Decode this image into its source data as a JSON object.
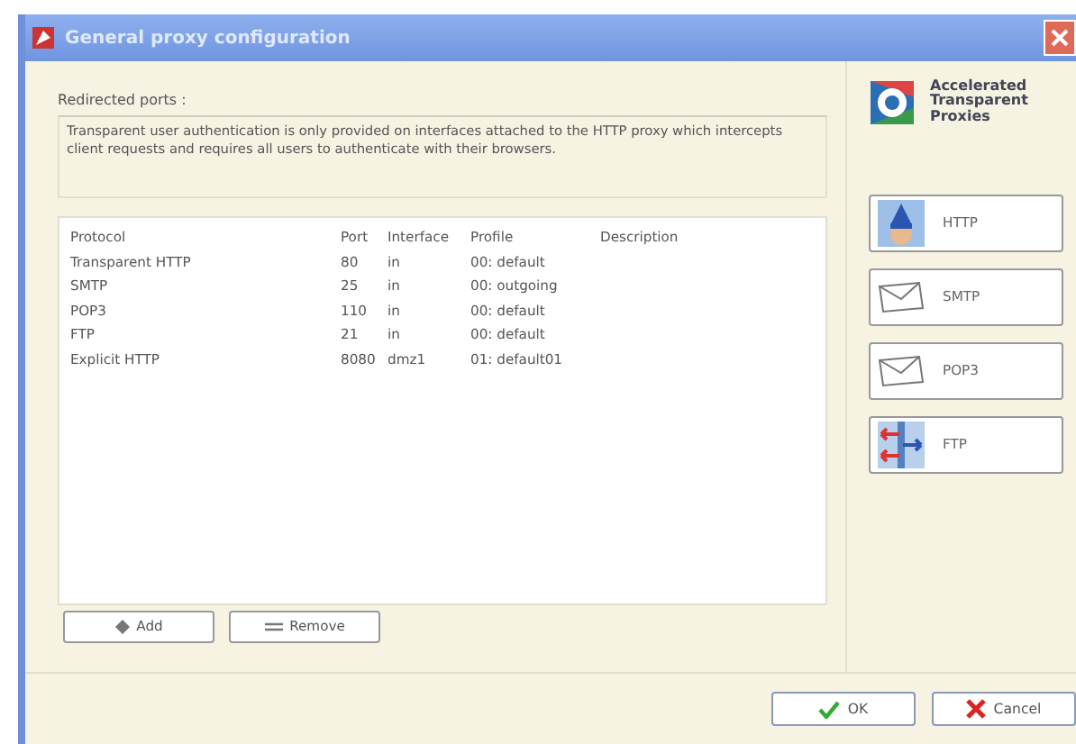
{
  "window": {
    "title": "General proxy configuration"
  },
  "section_label": "Redirected ports :",
  "note": "Transparent user authentication is only provided on interfaces attached to the HTTP proxy which intercepts client requests and requires all users to authenticate with their browsers.",
  "table": {
    "columns": [
      "Protocol",
      "Port",
      "Interface",
      "Profile",
      "Description"
    ],
    "rows": [
      {
        "cells": [
          "Transparent HTTP",
          "80",
          "in",
          "00: default"
        ]
      },
      {
        "cells": [
          "SMTP",
          "25",
          "in",
          "00: outgoing"
        ]
      },
      {
        "cells": [
          "POP3",
          "110",
          "in",
          "00: default"
        ]
      },
      {
        "cells": [
          "FTP",
          "21",
          "in",
          "00: default"
        ]
      },
      {
        "cells": [
          "Explicit HTTP",
          "8080",
          "dmz1",
          "01: default01"
        ]
      }
    ]
  },
  "list_buttons": [
    {
      "label": "Add",
      "kind": "add"
    },
    {
      "label": "Remove",
      "kind": "remove"
    }
  ],
  "sidebar": {
    "heading": "Accelerated Transparent Proxies",
    "buttons": [
      {
        "label": "HTTP",
        "kind": "http"
      },
      {
        "label": "SMTP",
        "kind": "mail"
      },
      {
        "label": "POP3",
        "kind": "mail"
      },
      {
        "label": "FTP",
        "kind": "ftp"
      }
    ]
  },
  "dialog_buttons": [
    {
      "label": "OK",
      "kind": "ok"
    },
    {
      "label": "Cancel",
      "kind": "cancel"
    }
  ]
}
